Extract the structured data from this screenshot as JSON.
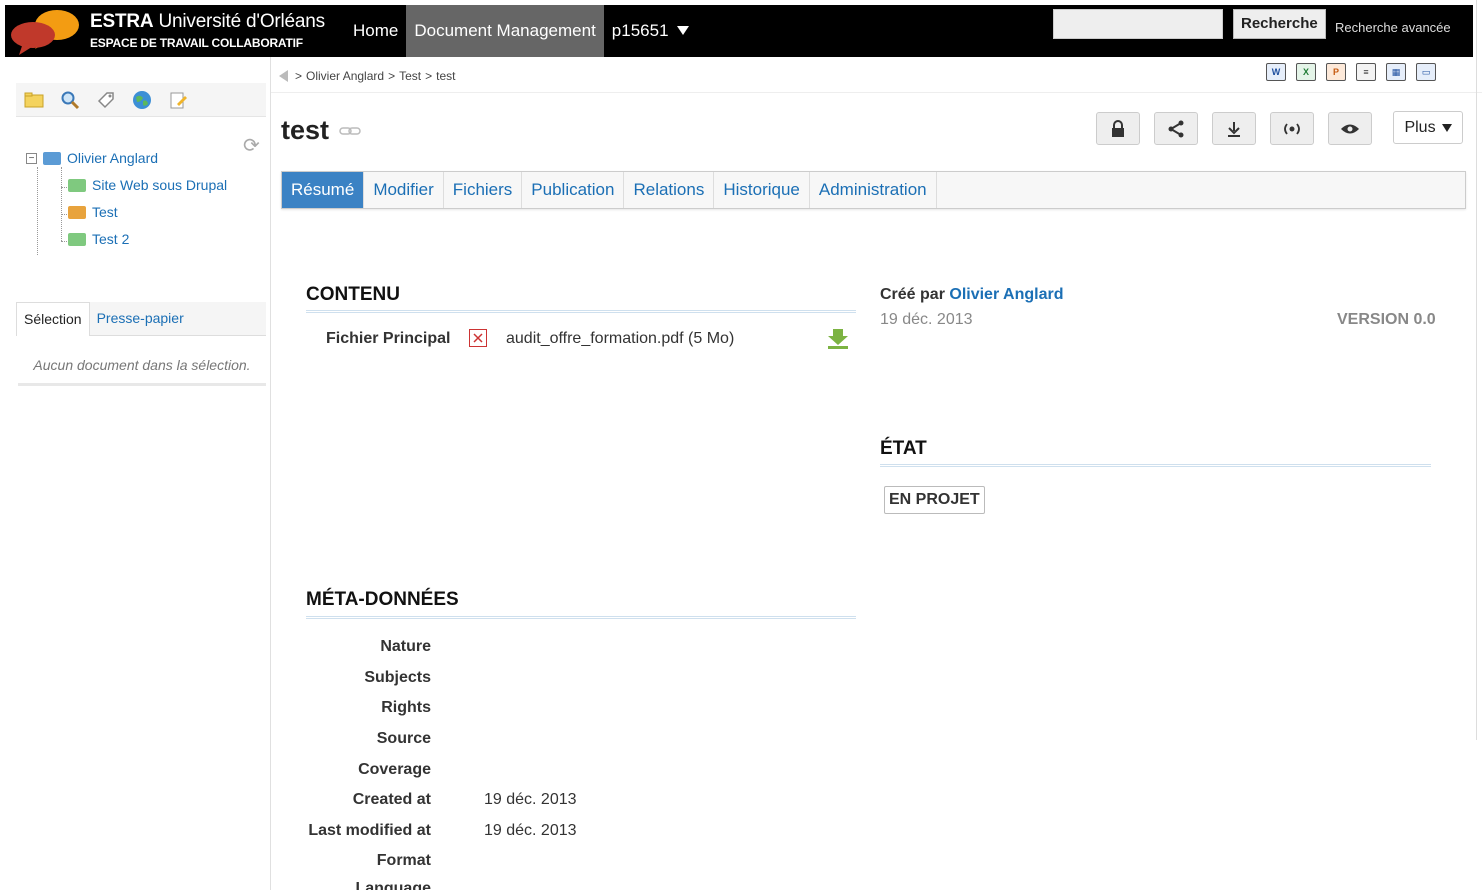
{
  "header": {
    "logo_title_bold": "ESTRA",
    "logo_title_rest": " Université d'Orléans",
    "logo_subtitle": "ESPACE DE TRAVAIL COLLABORATIF",
    "nav": [
      {
        "label": "Home"
      },
      {
        "label": "Document Management",
        "active": true
      },
      {
        "label": "p15651"
      }
    ],
    "search_placeholder": "",
    "search_button": "Recherche",
    "advanced_search": "Recherche avancée"
  },
  "sidebar": {
    "tree": [
      {
        "label": "Olivier Anglard",
        "color": "#5b9bd5"
      },
      {
        "label": "Site Web sous Drupal",
        "color": "#7fc97f"
      },
      {
        "label": "Test",
        "color": "#e8a33d"
      },
      {
        "label": "Test 2",
        "color": "#7fc97f"
      }
    ],
    "tabs": [
      {
        "label": "Sélection",
        "active": true
      },
      {
        "label": "Presse-papier"
      }
    ],
    "selection_empty": "Aucun document dans la sélection."
  },
  "breadcrumb": {
    "items": [
      "Olivier Anglard",
      "Test",
      "test"
    ],
    "separator": ">"
  },
  "document": {
    "title": "test",
    "more_label": "Plus",
    "tabs": [
      {
        "label": "Résumé",
        "active": true
      },
      {
        "label": "Modifier"
      },
      {
        "label": "Fichiers"
      },
      {
        "label": "Publication"
      },
      {
        "label": "Relations"
      },
      {
        "label": "Historique"
      },
      {
        "label": "Administration"
      }
    ]
  },
  "content": {
    "heading": "CONTENU",
    "main_file_label": "Fichier Principal",
    "main_file_value": "audit_offre_formation.pdf (5 Mo)"
  },
  "info": {
    "created_by_label": "Créé par",
    "created_by_user": "Olivier Anglard",
    "created_date": "19 déc. 2013",
    "version": "VERSION 0.0"
  },
  "state": {
    "heading": "ÉTAT",
    "status": "EN PROJET"
  },
  "metadata": {
    "heading": "MÉTA-DONNÉES",
    "rows": [
      {
        "label": "Nature",
        "value": ""
      },
      {
        "label": "Subjects",
        "value": ""
      },
      {
        "label": "Rights",
        "value": ""
      },
      {
        "label": "Source",
        "value": ""
      },
      {
        "label": "Coverage",
        "value": ""
      },
      {
        "label": "Created at",
        "value": "19 déc. 2013"
      },
      {
        "label": "Last modified at",
        "value": "19 déc. 2013"
      },
      {
        "label": "Format",
        "value": ""
      },
      {
        "label": "Language",
        "value": ""
      }
    ]
  },
  "colors": {
    "link": "#1b6fb5",
    "tab_active": "#3b82c4",
    "topbar": "#000000"
  }
}
